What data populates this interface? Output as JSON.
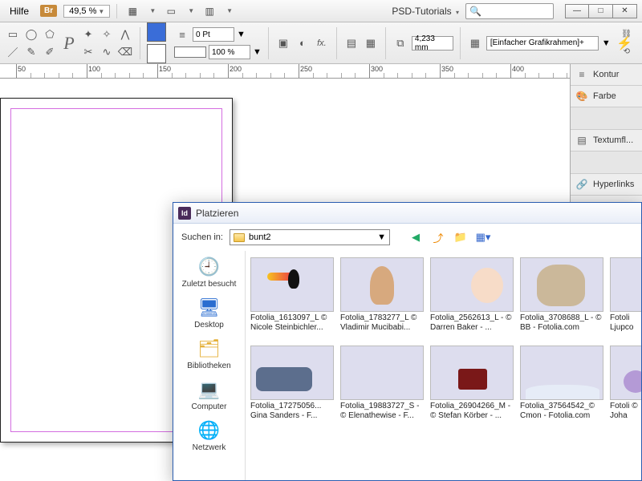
{
  "menubar": {
    "help": "Hilfe",
    "br_badge": "Br",
    "zoom": "49,5 %",
    "doc_label": "PSD-Tutorials",
    "search_placeholder": "",
    "min": "—",
    "max": "□",
    "close": "✕"
  },
  "toolbar": {
    "stroke_pt": "0 Pt",
    "opacity": "100 %",
    "size_mm": "4,233 mm",
    "frame_mode": "[Einfacher Grafikrahmen]+"
  },
  "ruler": {
    "labels": [
      "50",
      "100",
      "150",
      "200",
      "250",
      "300",
      "350",
      "400"
    ]
  },
  "rightdock": {
    "kontur": "Kontur",
    "farbe": "Farbe",
    "textumfl": "Textumfl...",
    "hyperlinks": "Hyperlinks"
  },
  "dialog": {
    "title": "Platzieren",
    "search_label": "Suchen in:",
    "folder": "bunt2",
    "places": {
      "recent": "Zuletzt besucht",
      "desktop": "Desktop",
      "libraries": "Bibliotheken",
      "computer": "Computer",
      "network": "Netzwerk"
    },
    "files_row1": [
      {
        "name": "Fotolia_1613097_L © Nicole Steinbichler..."
      },
      {
        "name": "Fotolia_1783277_L © Vladimir Mucibabi..."
      },
      {
        "name": "Fotolia_2562613_L - © Darren Baker - ..."
      },
      {
        "name": "Fotolia_3708688_L - © BB - Fotolia.com"
      },
      {
        "name": "Fotoli Ljupco"
      }
    ],
    "files_row2": [
      {
        "name": "Fotolia_17275056... Gina Sanders - F..."
      },
      {
        "name": "Fotolia_19883727_S - © Elenathewise - F..."
      },
      {
        "name": "Fotolia_26904266_M - © Stefan Körber - ..."
      },
      {
        "name": "Fotolia_37564542_© Cmon - Fotolia.com"
      },
      {
        "name": "Fotoli © Joha"
      }
    ]
  },
  "chart_data": null
}
